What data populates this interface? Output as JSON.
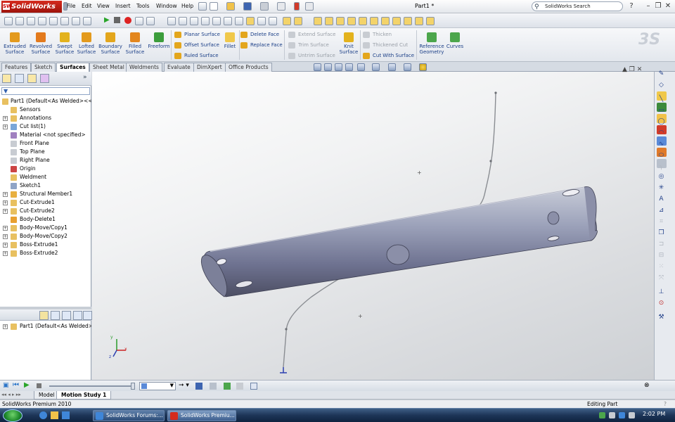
{
  "app": {
    "brand": "SolidWorks",
    "doc_title": "Part1 *",
    "search_placeholder": "SolidWorks Search",
    "menus": [
      "File",
      "Edit",
      "View",
      "Insert",
      "Tools",
      "Window",
      "Help"
    ],
    "help_label": "?"
  },
  "command_manager": {
    "big_buttons": [
      {
        "label": "Extruded Surface",
        "color": "#e39a1d"
      },
      {
        "label": "Revolved Surface",
        "color": "#e37a1d"
      },
      {
        "label": "Swept Surface",
        "color": "#e3b21d"
      },
      {
        "label": "Lofted Surface",
        "color": "#e39a1d"
      },
      {
        "label": "Boundary Surface",
        "color": "#e3a61d"
      },
      {
        "label": "Filled Surface",
        "color": "#e3861d"
      },
      {
        "label": "Freeform",
        "color": "#3c9d3c"
      }
    ],
    "col1": [
      "Planar Surface",
      "Offset Surface",
      "Ruled Surface"
    ],
    "fillet": "Fillet",
    "col2": [
      "Delete Face",
      "Replace Face"
    ],
    "col3": [
      "Extend Surface",
      "Trim Surface",
      "Untrim Surface"
    ],
    "knit": "Knit Surface",
    "col4": [
      "Thicken",
      "Thickened Cut",
      "Cut With Surface"
    ],
    "refgeo": "Reference Geometry",
    "curves": "Curves"
  },
  "tabs": [
    "Features",
    "Sketch",
    "Surfaces",
    "Sheet Metal",
    "Weldments",
    "Evaluate",
    "DimXpert",
    "Office Products"
  ],
  "active_tab": "Surfaces",
  "feature_tree": {
    "root": "Part1  (Default<As Welded><<D",
    "items": [
      {
        "label": "Sensors",
        "icon": "sensor-icon",
        "color": "#e8c060",
        "expand": ""
      },
      {
        "label": "Annotations",
        "icon": "annotation-icon",
        "color": "#e8c060",
        "expand": "+"
      },
      {
        "label": "Cut list(1)",
        "icon": "cut-list-icon",
        "color": "#7aa6d8",
        "expand": "+"
      },
      {
        "label": "Material <not specified>",
        "icon": "material-icon",
        "color": "#a080c0",
        "expand": ""
      },
      {
        "label": "Front Plane",
        "icon": "plane-icon",
        "color": "#c8ccd2",
        "expand": ""
      },
      {
        "label": "Top Plane",
        "icon": "plane-icon",
        "color": "#c8ccd2",
        "expand": ""
      },
      {
        "label": "Right Plane",
        "icon": "plane-icon",
        "color": "#c8ccd2",
        "expand": ""
      },
      {
        "label": "Origin",
        "icon": "origin-icon",
        "color": "#cc4444",
        "expand": ""
      },
      {
        "label": "Weldment",
        "icon": "weldment-icon",
        "color": "#e8c060",
        "expand": ""
      },
      {
        "label": "Sketch1",
        "icon": "sketch-icon",
        "color": "#8fa4c6",
        "expand": ""
      },
      {
        "label": "Structural Member1",
        "icon": "structural-member-icon",
        "color": "#e8b040",
        "expand": "+"
      },
      {
        "label": "Cut-Extrude1",
        "icon": "cut-extrude-icon",
        "color": "#e8c060",
        "expand": "+"
      },
      {
        "label": "Cut-Extrude2",
        "icon": "cut-extrude-icon",
        "color": "#e8c060",
        "expand": "+"
      },
      {
        "label": "Body-Delete1",
        "icon": "body-delete-icon",
        "color": "#e8a030",
        "expand": ""
      },
      {
        "label": "Body-Move/Copy1",
        "icon": "body-move-icon",
        "color": "#e8c060",
        "expand": "+"
      },
      {
        "label": "Body-Move/Copy2",
        "icon": "body-move-icon",
        "color": "#e8c060",
        "expand": "+"
      },
      {
        "label": "Boss-Extrude1",
        "icon": "boss-extrude-icon",
        "color": "#e8c060",
        "expand": "+"
      },
      {
        "label": "Boss-Extrude2",
        "icon": "boss-extrude-icon",
        "color": "#e8c060",
        "expand": "+"
      }
    ],
    "config_item": "Part1  (Default<As Welded><"
  },
  "motion": {
    "tabs": [
      "Model",
      "Motion Study 1"
    ],
    "active": "Motion Study 1"
  },
  "status": {
    "left": "SolidWorks Premium 2010",
    "right": "Editing Part"
  },
  "taskbar": {
    "buttons": [
      "SolidWorks Forums:...",
      "SolidWorks Premiu..."
    ],
    "clock": "2:02 PM"
  },
  "axes": {
    "x": "x",
    "y": "y",
    "z": "z"
  }
}
